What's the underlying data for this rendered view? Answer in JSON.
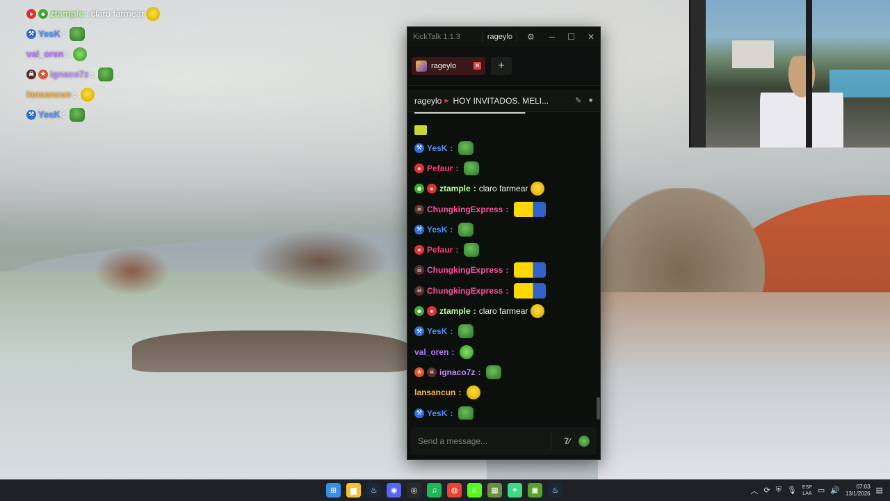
{
  "colors": {
    "yesk": "#4f8dff",
    "pefaur": "#ff3b7a",
    "ztample": "#b6ff9a",
    "chungking": "#ff4f9d",
    "val_oren": "#b877ff",
    "ignaco7z": "#c08cff",
    "lansancun": "#ffb030",
    "kick_green": "#53fc18"
  },
  "overlay": {
    "lines": [
      {
        "user": "ztample",
        "badges": [
          "red-circle-icon",
          "alien-icon"
        ],
        "sep": ":",
        "text": "claro farmear",
        "emote": "yellow-emote",
        "color": "#b6ff9a"
      },
      {
        "user": "YesK",
        "badges": [
          "hammer-icon"
        ],
        "sep": ":",
        "text": "",
        "emote": "pepe-emote",
        "color": "#4f8dff"
      },
      {
        "user": "val_oren",
        "badges": [],
        "sep": ":",
        "text": "",
        "emote": "kiss-emote",
        "color": "#b877ff"
      },
      {
        "user": "ignaco7z",
        "badges": [
          "skull-icon",
          "sub-icon"
        ],
        "sep": ":",
        "text": "",
        "emote": "pepe-emote",
        "color": "#c08cff"
      },
      {
        "user": "lansancun",
        "badges": [],
        "sep": ":",
        "text": "",
        "emote": "yellow-emote",
        "color": "#ffb030"
      },
      {
        "user": "YesK",
        "badges": [
          "hammer-icon"
        ],
        "sep": ":",
        "text": "",
        "emote": "pepe-emote",
        "color": "#4f8dff"
      }
    ]
  },
  "kicktalk": {
    "app_title": "KickTalk 1.1.3",
    "title_user": "rageylo",
    "tab_label": "rageylo",
    "tab_add": "+",
    "channel_name": "rageylo",
    "stream_title": "HOY INVITADOS. MELI...",
    "input_placeholder": "Send a message...",
    "messages": [
      {
        "user": "YesK",
        "badges": [
          "hammer-icon"
        ],
        "text": "",
        "emote": "pepe-emote",
        "color": "#4f8dff"
      },
      {
        "user": "Pefaur",
        "badges": [
          "red-circle-icon"
        ],
        "text": "",
        "emote": "pepe-emote",
        "color": "#ff3b7a"
      },
      {
        "user": "ztample",
        "badges": [
          "alien-icon",
          "red-circle-icon"
        ],
        "text": "claro farmear",
        "emote": "yellow-emote",
        "color": "#b6ff9a"
      },
      {
        "user": "ChungkingExpress",
        "badges": [
          "skull-icon"
        ],
        "text": "",
        "emote": "minion-emote",
        "color": "#ff4f9d"
      },
      {
        "user": "YesK",
        "badges": [
          "hammer-icon"
        ],
        "text": "",
        "emote": "pepe-emote",
        "color": "#4f8dff"
      },
      {
        "user": "Pefaur",
        "badges": [
          "red-circle-icon"
        ],
        "text": "",
        "emote": "pepe-emote",
        "color": "#ff3b7a"
      },
      {
        "user": "ChungkingExpress",
        "badges": [
          "skull-icon"
        ],
        "text": "",
        "emote": "minion-emote",
        "color": "#ff4f9d"
      },
      {
        "user": "ChungkingExpress",
        "badges": [
          "skull-icon"
        ],
        "text": "",
        "emote": "minion-emote",
        "color": "#ff4f9d"
      },
      {
        "user": "ztample",
        "badges": [
          "alien-icon",
          "red-circle-icon"
        ],
        "text": "claro farmear",
        "emote": "yellow-emote",
        "color": "#b6ff9a"
      },
      {
        "user": "YesK",
        "badges": [
          "hammer-icon"
        ],
        "text": "",
        "emote": "pepe-emote",
        "color": "#4f8dff"
      },
      {
        "user": "val_oren",
        "badges": [],
        "text": "",
        "emote": "kiss-emote",
        "color": "#b877ff"
      },
      {
        "user": "ignaco7z",
        "badges": [
          "sub-icon",
          "skull-icon"
        ],
        "text": "",
        "emote": "pepe-emote",
        "color": "#c08cff"
      },
      {
        "user": "lansancun",
        "badges": [],
        "text": "",
        "emote": "yellow-emote",
        "color": "#ffb030"
      },
      {
        "user": "YesK",
        "badges": [
          "hammer-icon"
        ],
        "text": "",
        "emote": "pepe-emote",
        "color": "#4f8dff"
      }
    ]
  },
  "taskbar": {
    "apps": [
      "windows-start-icon",
      "file-explorer-icon",
      "steam-icon",
      "discord-icon",
      "chrome-dev-icon",
      "spotify-icon",
      "chrome-icon",
      "kick-icon",
      "game-icon",
      "android-icon",
      "minecraft-icon",
      "steam-icon-2"
    ],
    "lang_line1": "ESP",
    "lang_line2": "LAA",
    "time": "07:03",
    "date": "13/1/2026"
  }
}
